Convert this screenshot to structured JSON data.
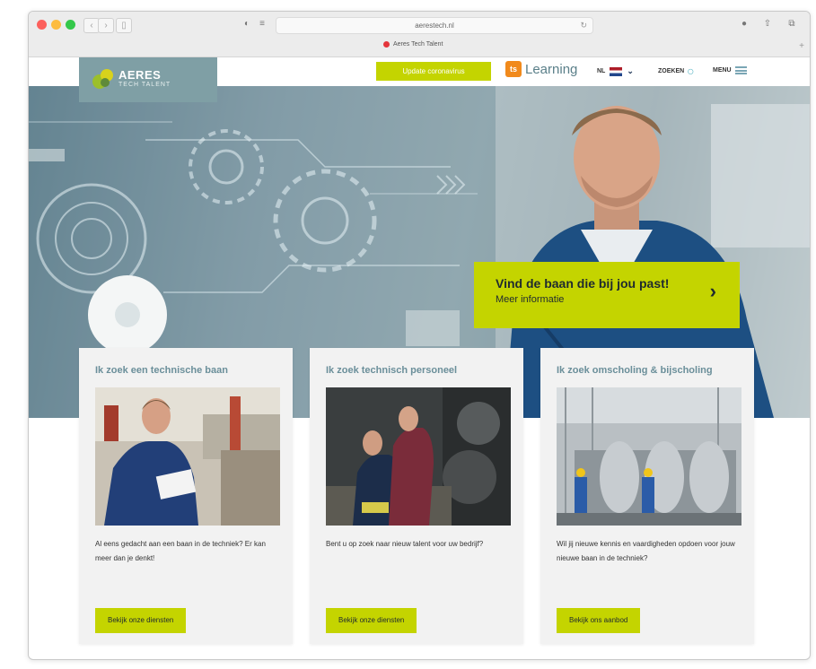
{
  "browser": {
    "url": "aerestech.nl",
    "tab_title": "Aeres Tech Talent"
  },
  "header": {
    "logo_name": "AERES",
    "logo_sub": "TECH TALENT",
    "update_button": "Update coronavirus",
    "learning_label": "Learning",
    "learning_mark": "ts",
    "language": "NL",
    "search_label": "ZOEKEN",
    "menu_label": "MENU"
  },
  "hero": {
    "title": "Vind de baan die bij jou past!",
    "subtitle": "Meer informatie",
    "arrow": "›"
  },
  "cards": [
    {
      "title": "Ik zoek een technische baan",
      "text": "Al eens gedacht aan een baan in de techniek? Er kan meer dan je denkt!",
      "button": "Bekijk onze diensten"
    },
    {
      "title": "Ik zoek technisch personeel",
      "text": "Bent u op zoek naar nieuw talent voor uw bedrijf?",
      "button": "Bekijk onze diensten"
    },
    {
      "title": "Ik zoek omscholing & bijscholing",
      "text": "Wil jij nieuwe kennis en vaardigheden opdoen voor jouw nieuwe baan in de techniek?",
      "button": "Bekijk ons aanbod"
    }
  ],
  "colors": {
    "accent": "#c4d400",
    "logo_bg": "#7f9fa5",
    "title_teal": "#6b8f9a",
    "learning_orange": "#f18a1c"
  }
}
